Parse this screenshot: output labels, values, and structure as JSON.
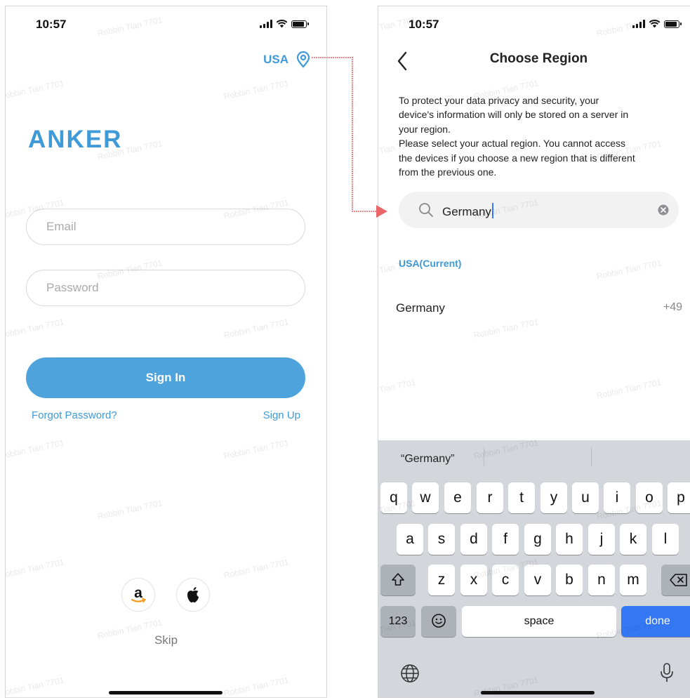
{
  "left_screen": {
    "status": {
      "time": "10:57"
    },
    "region": {
      "label": "USA"
    },
    "logo": "ANKER",
    "email": {
      "placeholder": "Email"
    },
    "password": {
      "placeholder": "Password"
    },
    "sign_in_label": "Sign In",
    "forgot_label": "Forgot Password?",
    "sign_up_label": "Sign Up",
    "skip_label": "Skip",
    "social": [
      "amazon-icon",
      "apple-icon"
    ]
  },
  "right_screen": {
    "status": {
      "time": "10:57"
    },
    "title": "Choose Region",
    "notice_lines": [
      "To protect your data privacy and security, your",
      "device's information will only be stored on a server in",
      "your region.",
      "Please select your actual region. You cannot access",
      "the devices if you choose a new region that is different",
      "from the previous one."
    ],
    "search": {
      "value": "Germany"
    },
    "current_label": "USA(Current)",
    "result": {
      "name": "Germany",
      "code": "+49"
    },
    "keyboard": {
      "suggestion": "“Germany”",
      "row1": [
        "q",
        "w",
        "e",
        "r",
        "t",
        "y",
        "u",
        "i",
        "o",
        "p"
      ],
      "row2": [
        "a",
        "s",
        "d",
        "f",
        "g",
        "h",
        "j",
        "k",
        "l"
      ],
      "row3": [
        "z",
        "x",
        "c",
        "v",
        "b",
        "n",
        "m"
      ],
      "numbers_label": "123",
      "space_label": "space",
      "done_label": "done"
    }
  },
  "watermark": "Robbin Tian 7701",
  "colors": {
    "accent": "#3f9ad8",
    "button": "#4ea3dc",
    "keyboard_done": "#3478f6",
    "connector": "#e8676b"
  }
}
